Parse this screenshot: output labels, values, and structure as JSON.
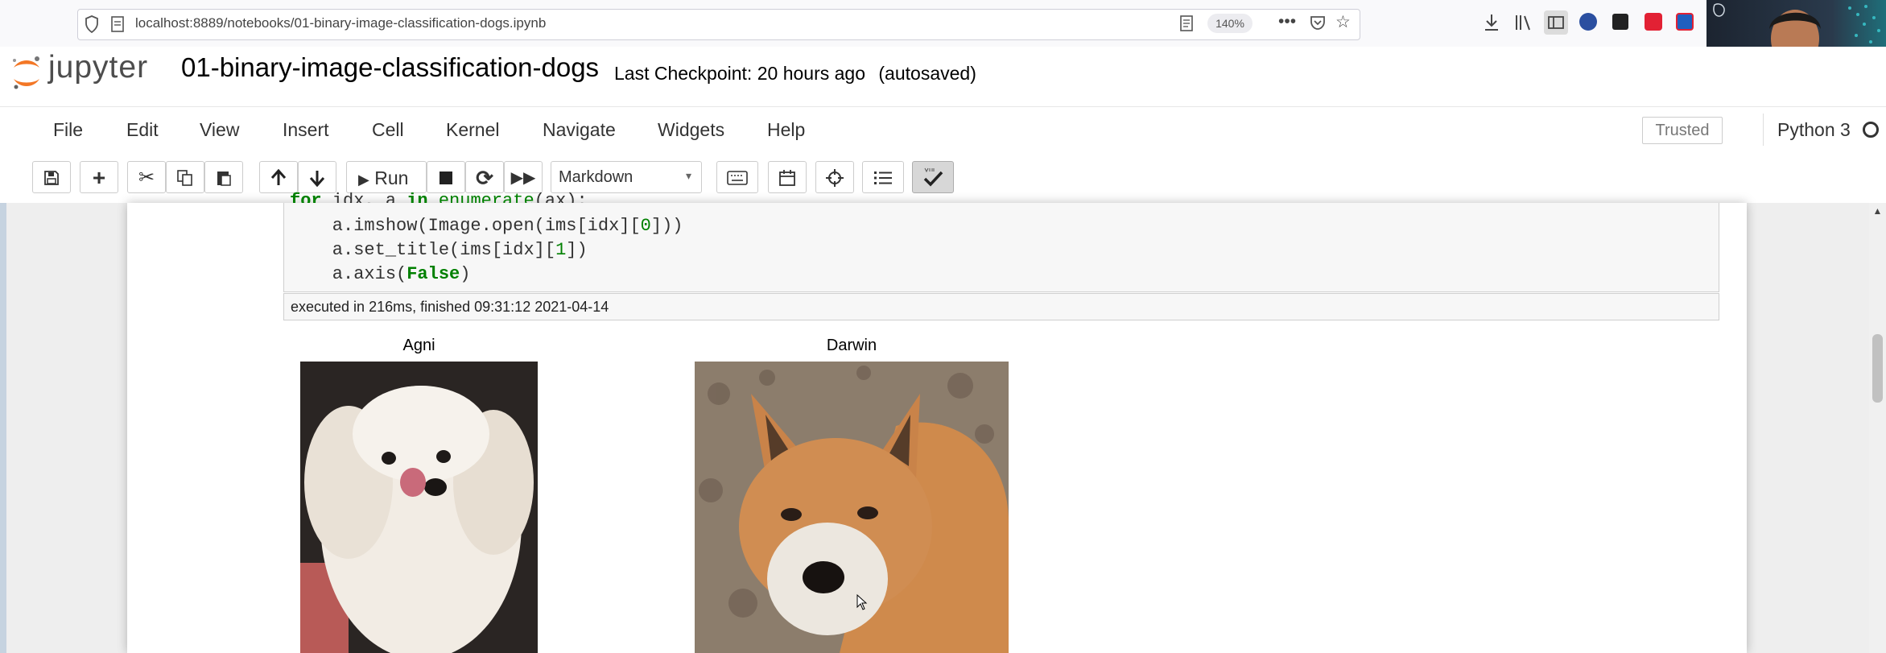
{
  "browser": {
    "url": "localhost:8889/notebooks/01-binary-image-classification-dogs.ipynb",
    "zoom": "140%"
  },
  "jupyter": {
    "logo_text": "jupyter",
    "notebook_title": "01-binary-image-classification-dogs",
    "checkpoint_label": "Last Checkpoint:",
    "checkpoint_time": "20 hours ago",
    "autosave_status": "(autosaved)"
  },
  "menubar": {
    "items": [
      "File",
      "Edit",
      "View",
      "Insert",
      "Cell",
      "Kernel",
      "Navigate",
      "Widgets",
      "Help"
    ],
    "trusted_label": "Trusted",
    "kernel_name": "Python 3"
  },
  "toolbar": {
    "run_label": "Run",
    "cell_type": "Markdown"
  },
  "cell": {
    "code_lines": [
      "for idx, a in enumerate(ax):",
      "    a.imshow(Image.open(ims[idx][0]))",
      "    a.set_title(ims[idx][1])",
      "    a.axis(False)"
    ],
    "execution_info": "executed in 216ms, finished 09:31:12 2021-04-14",
    "outputs": [
      {
        "title": "Agni"
      },
      {
        "title": "Darwin"
      }
    ]
  },
  "colors": {
    "jupyter_orange": "#f37726",
    "code_keyword": "#008000",
    "page_background": "#eeeeee"
  }
}
